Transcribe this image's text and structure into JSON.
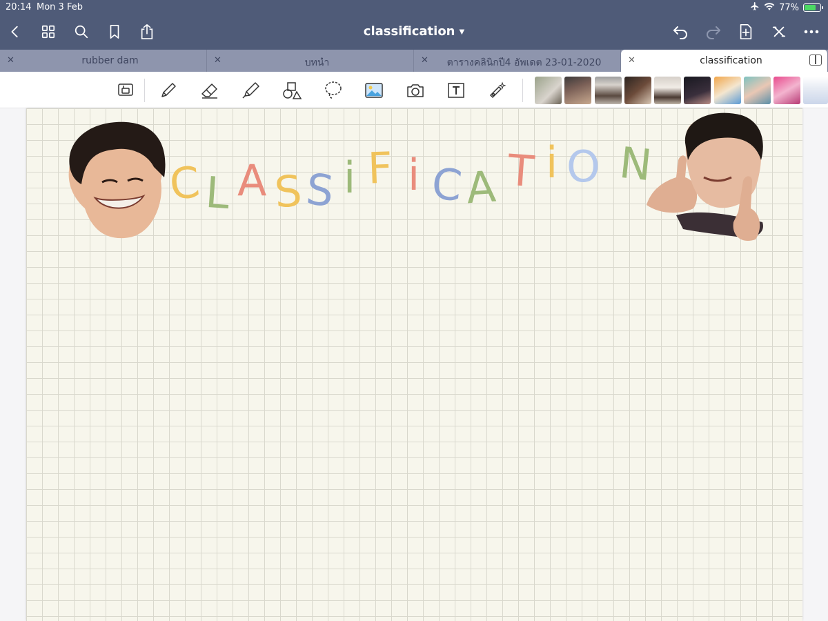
{
  "status": {
    "time": "20:14",
    "date": "Mon 3 Feb",
    "battery_percent": "77%",
    "battery_level": 0.77
  },
  "nav": {
    "title": "classification",
    "icons": [
      "back-icon",
      "grid-icon",
      "search-icon",
      "bookmark-icon",
      "share-icon",
      "undo-icon",
      "redo-icon",
      "add-page-icon",
      "close-icon",
      "more-icon"
    ]
  },
  "tabs": [
    {
      "label": "rubber dam",
      "active": false
    },
    {
      "label": "บทนำ",
      "active": false
    },
    {
      "label": "ตารางคลินิกปี4 อัพเดต 23-01-2020",
      "active": false
    },
    {
      "label": "classification",
      "active": true
    }
  ],
  "toolbar": {
    "tools": [
      "zoom-window-icon",
      "pen-icon",
      "eraser-icon",
      "highlighter-icon",
      "shapes-icon",
      "lasso-icon",
      "image-icon",
      "camera-icon",
      "text-icon",
      "laser-pointer-icon"
    ]
  },
  "colors": {
    "navbar": "#4f5b78",
    "tabbar": "#8e95ad",
    "page": "#f7f6ec",
    "letter_yellow": "#f0c35c",
    "letter_green": "#9dba7a",
    "letter_pink": "#e98c7c",
    "letter_blue": "#8da3d3",
    "letter_lightblue": "#b4c8ec"
  },
  "page": {
    "heading_letters": [
      {
        "ch": "C",
        "color": "#f0c35c"
      },
      {
        "ch": "L",
        "color": "#9dba7a"
      },
      {
        "ch": "A",
        "color": "#e98c7c"
      },
      {
        "ch": "S",
        "color": "#f0c35c"
      },
      {
        "ch": "S",
        "color": "#8da3d3"
      },
      {
        "ch": "i",
        "color": "#9dba7a"
      },
      {
        "ch": "F",
        "color": "#f0c35c"
      },
      {
        "ch": "i",
        "color": "#e98c7c"
      },
      {
        "ch": "C",
        "color": "#8da3d3"
      },
      {
        "ch": "A",
        "color": "#9dba7a"
      },
      {
        "ch": "T",
        "color": "#e98c7c"
      },
      {
        "ch": "i",
        "color": "#f0c35c"
      },
      {
        "ch": "O",
        "color": "#b4c8ec"
      },
      {
        "ch": "N",
        "color": "#9dba7a"
      }
    ]
  }
}
